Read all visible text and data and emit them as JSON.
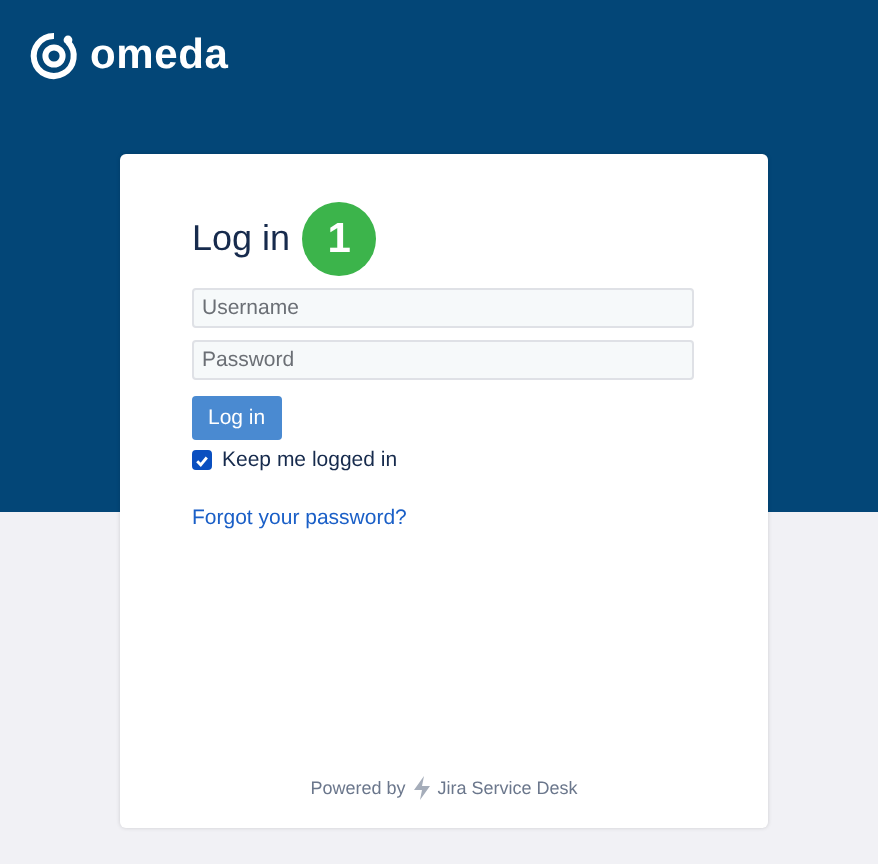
{
  "brand": {
    "name": "omeda"
  },
  "login": {
    "title": "Log in",
    "step_badge": "1",
    "username": {
      "placeholder": "Username"
    },
    "password": {
      "placeholder": "Password"
    },
    "submit": "Log in",
    "remember": {
      "label": "Keep me logged in",
      "checked": true
    },
    "forgot_link": "Forgot your password?"
  },
  "footer": {
    "prefix": "Powered by",
    "product": "Jira Service Desk"
  }
}
